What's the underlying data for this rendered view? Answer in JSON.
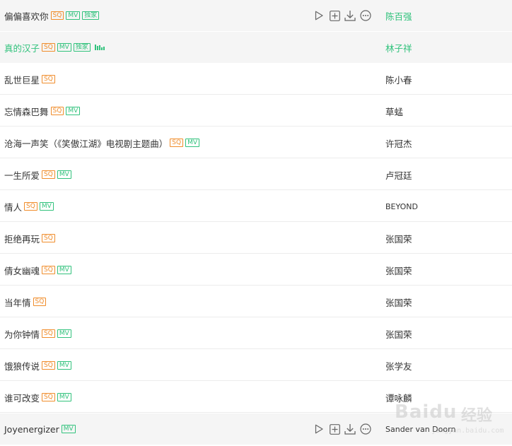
{
  "songs": [
    {
      "title": "偏偏喜欢你",
      "badges": [
        "SQ",
        "MV",
        "独家"
      ],
      "artist": "陈百强",
      "state": "hover"
    },
    {
      "title": "真的汉子",
      "badges": [
        "SQ",
        "MV",
        "独家"
      ],
      "artist": "林子祥",
      "state": "playing"
    },
    {
      "title": "乱世巨星",
      "badges": [
        "SQ"
      ],
      "artist": "陈小春",
      "state": ""
    },
    {
      "title": "忘情森巴舞",
      "badges": [
        "SQ",
        "MV"
      ],
      "artist": "草蜢",
      "state": ""
    },
    {
      "title": "沧海一声笑（《笑傲江湖》电视剧主题曲）",
      "badges": [
        "SQ",
        "MV"
      ],
      "artist": "许冠杰",
      "state": ""
    },
    {
      "title": "一生所爱",
      "badges": [
        "SQ",
        "MV"
      ],
      "artist": "卢冠廷",
      "state": ""
    },
    {
      "title": "情人",
      "badges": [
        "SQ",
        "MV"
      ],
      "artist": "BEYOND",
      "state": ""
    },
    {
      "title": "拒绝再玩",
      "badges": [
        "SQ"
      ],
      "artist": "张国荣",
      "state": ""
    },
    {
      "title": "倩女幽魂",
      "badges": [
        "SQ",
        "MV"
      ],
      "artist": "张国荣",
      "state": ""
    },
    {
      "title": "当年情",
      "badges": [
        "SQ"
      ],
      "artist": "张国荣",
      "state": ""
    },
    {
      "title": "为你钟情",
      "badges": [
        "SQ",
        "MV"
      ],
      "artist": "张国荣",
      "state": ""
    },
    {
      "title": "饿狼传说",
      "badges": [
        "SQ",
        "MV"
      ],
      "artist": "张学友",
      "state": ""
    },
    {
      "title": "谁可改变",
      "badges": [
        "SQ",
        "MV"
      ],
      "artist": "谭咏麟",
      "state": ""
    },
    {
      "title": "Joyenergizer",
      "badges": [
        "MV"
      ],
      "artist": "Sander van Doorn",
      "state": "hover"
    }
  ],
  "actions": [
    {
      "name": "play-icon"
    },
    {
      "name": "add-icon"
    },
    {
      "name": "download-icon"
    },
    {
      "name": "more-icon"
    }
  ],
  "colors": {
    "accent": "#31c27c",
    "sq": "#f08c2a",
    "hover_bg": "#f5f5f5"
  },
  "watermark": {
    "brand": "Bai",
    "brand2": "du",
    "cn": "经验",
    "url": "jingyan.baidu.com"
  }
}
